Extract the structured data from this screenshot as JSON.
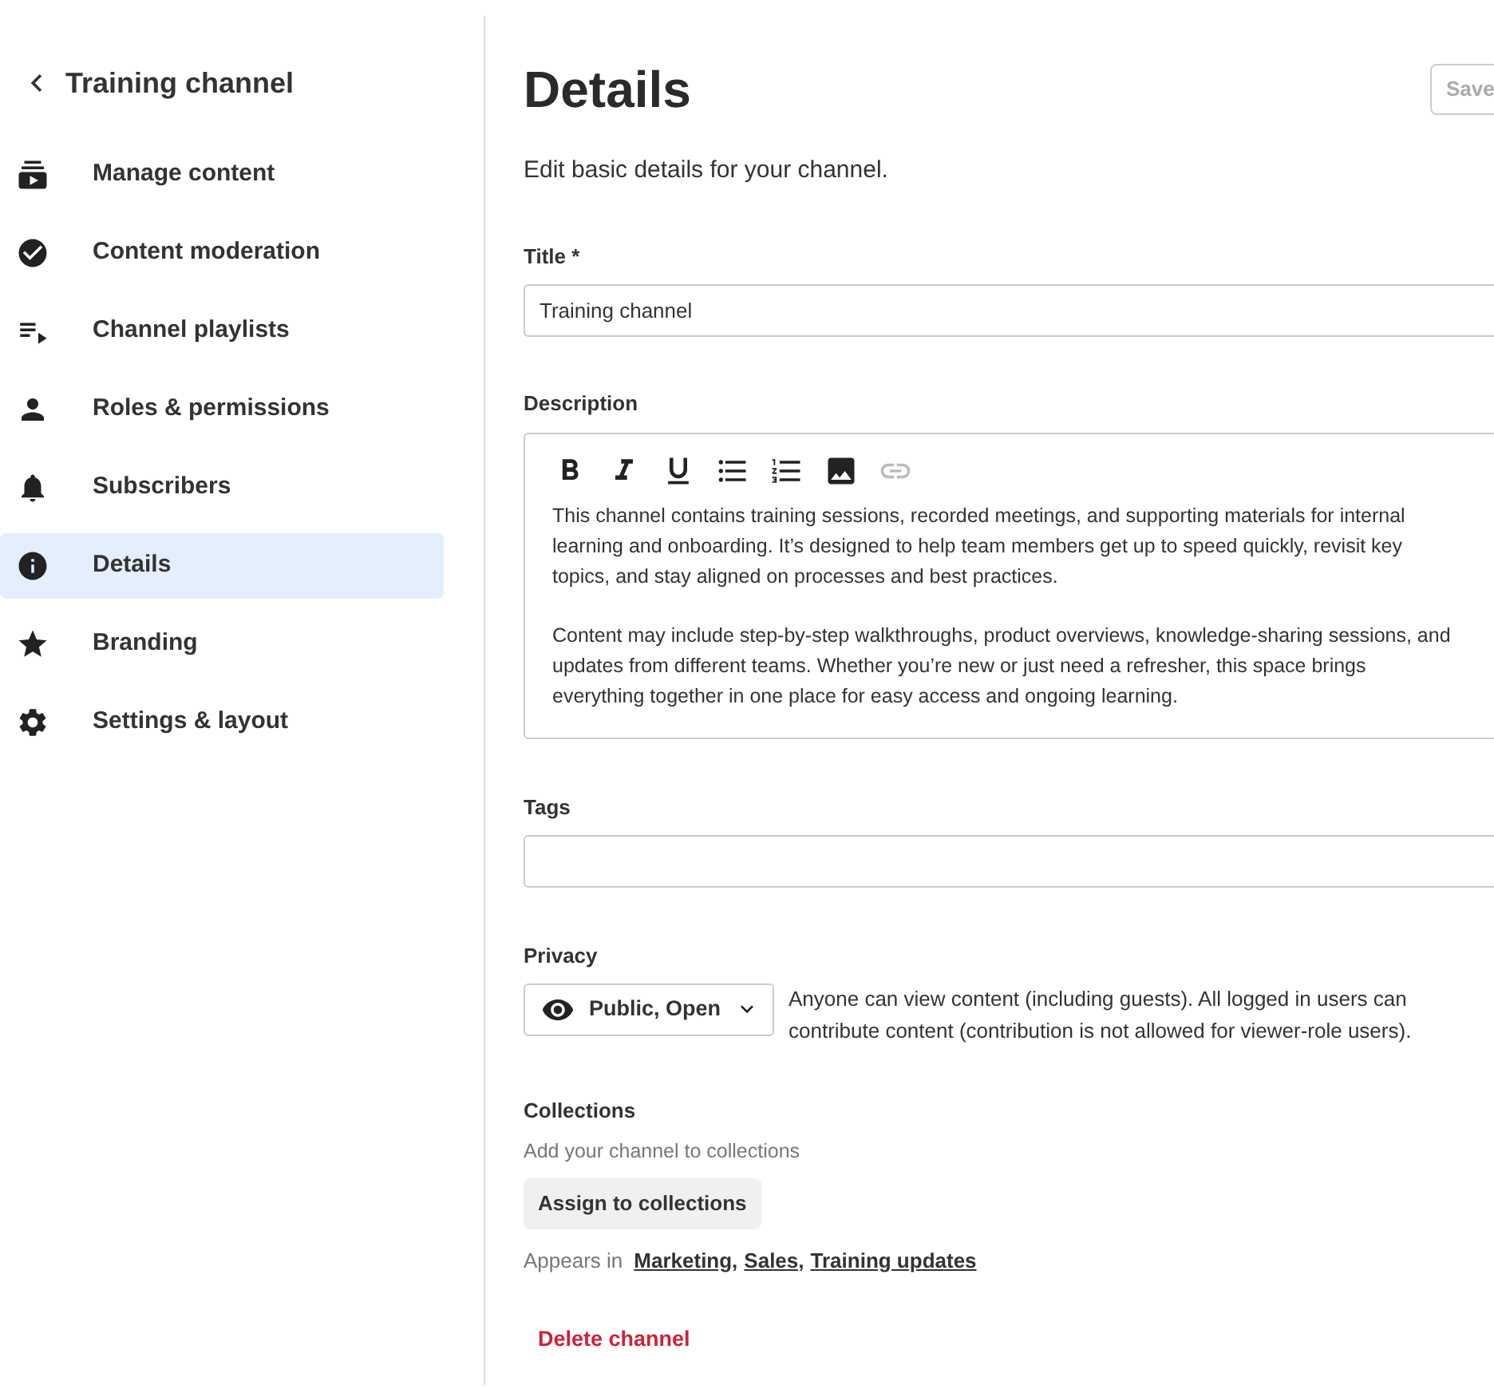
{
  "sidebar": {
    "back_title": "Training channel",
    "items": [
      {
        "label": "Manage content",
        "selected": false
      },
      {
        "label": "Content moderation",
        "selected": false
      },
      {
        "label": "Channel playlists",
        "selected": false
      },
      {
        "label": "Roles & permissions",
        "selected": false
      },
      {
        "label": "Subscribers",
        "selected": false
      },
      {
        "label": "Details",
        "selected": true
      },
      {
        "label": "Branding",
        "selected": false
      },
      {
        "label": "Settings & layout",
        "selected": false
      }
    ]
  },
  "header": {
    "title": "Details",
    "save_button": {
      "label": "Save",
      "disabled": true
    }
  },
  "intro": "Edit basic details for your channel.",
  "title_field": {
    "label": "Title *",
    "value": "Training channel"
  },
  "description": {
    "label": "Description",
    "toolbar": [
      {
        "kind": "bold",
        "disabled": false
      },
      {
        "kind": "italic",
        "disabled": false
      },
      {
        "kind": "underline",
        "disabled": false
      },
      {
        "kind": "bullets",
        "disabled": false
      },
      {
        "kind": "numbers",
        "disabled": false
      },
      {
        "kind": "image",
        "disabled": false
      },
      {
        "kind": "link",
        "disabled": true
      }
    ],
    "paragraphs": [
      "This channel contains training sessions, recorded meetings, and supporting materials for internal learning and onboarding. It’s designed to help team members get up to speed quickly, revisit key topics, and stay aligned on processes and best practices.",
      "Content may include step-by-step walkthroughs, product overviews, knowledge-sharing sessions, and updates from different teams. Whether you’re new or just need a refresher, this space brings everything together in one place for easy access and ongoing learning."
    ]
  },
  "tags": {
    "label": "Tags"
  },
  "privacy": {
    "label": "Privacy",
    "value": "Public, Open",
    "help": "Anyone can view content (including guests). All logged in users can contribute content (contribution is not allowed for viewer-role users)."
  },
  "collections": {
    "label": "Collections",
    "hint": "Add your channel to collections",
    "button": "Assign to collections",
    "appears_label": "Appears in",
    "links": [
      "Marketing,",
      "Sales,",
      "Training updates"
    ]
  },
  "delete_button": "Delete channel"
}
